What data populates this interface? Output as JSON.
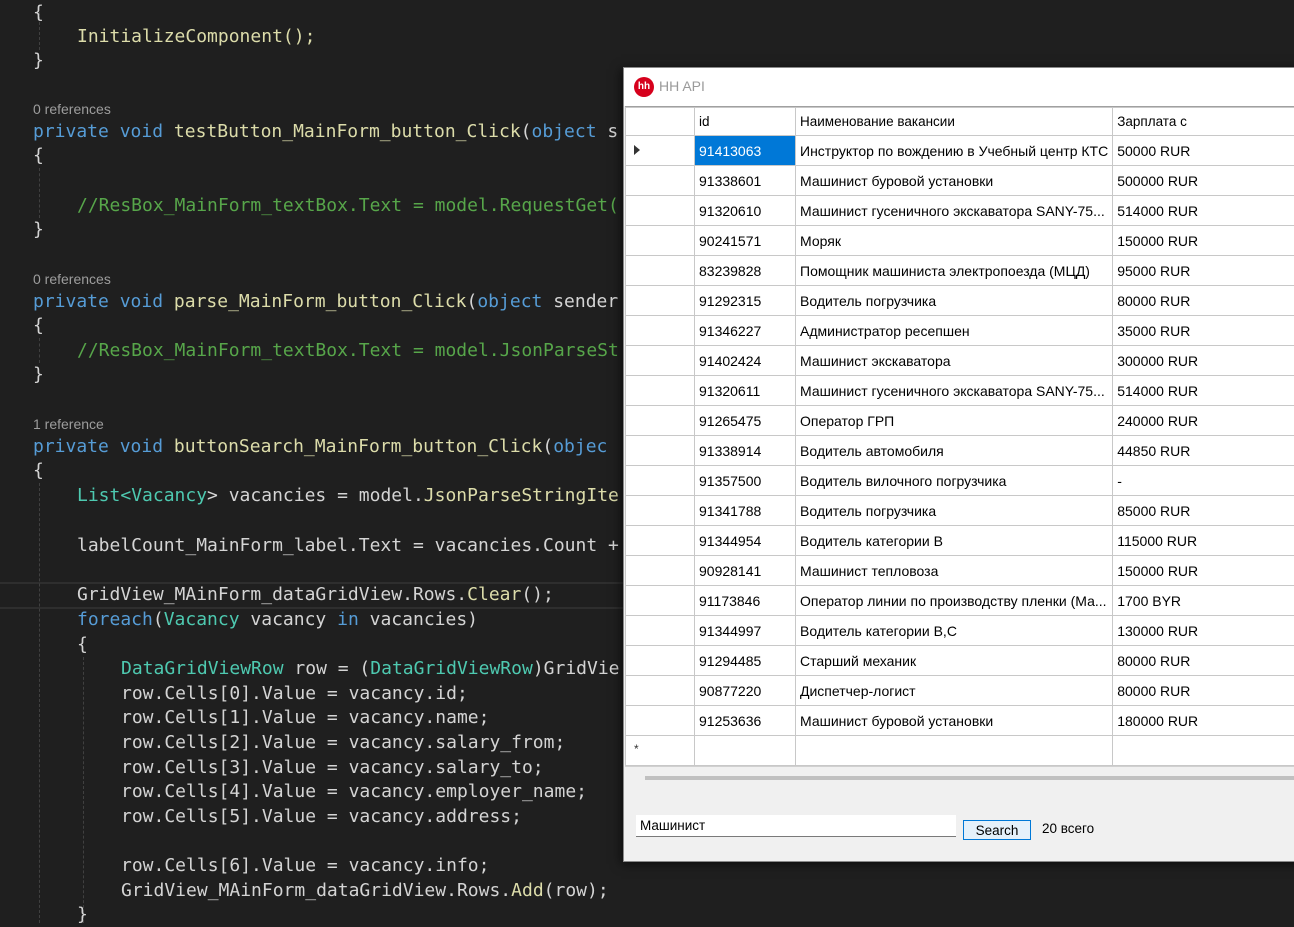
{
  "editor": {
    "lines": {
      "l1": "{",
      "l2": "InitializeComponent();",
      "l3": "}",
      "ref1": "0 references",
      "l5_kw": "private void",
      "l5_fn": "testButton_MainForm_button_Click",
      "l5_p": "(",
      "l5_ty": "object",
      "l5_rest": " s",
      "l6": "{",
      "l8": "//ResBox_MainForm_textBox.Text = model.RequestGet(",
      "l9": "}",
      "ref2": "0 references",
      "l11_kw": "private void",
      "l11_fn": "parse_MainForm_button_Click",
      "l11_p": "(",
      "l11_ty": "object",
      "l11_rest": " sender",
      "l12": "{",
      "l13": "//ResBox_MainForm_textBox.Text = model.JsonParseSt",
      "l14": "}",
      "ref3": "1 reference",
      "l16_kw": "private void",
      "l16_fn": "buttonSearch_MainForm_button_Click",
      "l16_p": "(",
      "l16_ty": "objec",
      "l17": "{",
      "l18_a": "List<",
      "l18_b": "Vacancy",
      "l18_c": "> vacancies = model.",
      "l18_d": "JsonParseStringIte",
      "l20_a": "labelCount_MainForm_label.Text = vacancies.Count +",
      "l22_a": "GridView_MAinForm_dataGridView.Rows.",
      "l22_b": "Clear",
      "l22_c": "();",
      "l23_a": "foreach",
      "l23_b": "(",
      "l23_c": "Vacancy",
      "l23_d": " vacancy ",
      "l23_e": "in",
      "l23_f": " vacancies)",
      "l24": "{",
      "l25_a": "DataGridViewRow",
      "l25_b": " row = (",
      "l25_c": "DataGridViewRow",
      "l25_d": ")GridVie",
      "l26": "row.Cells[0].Value = vacancy.id;",
      "l27": "row.Cells[1].Value = vacancy.name;",
      "l28": "row.Cells[2].Value = vacancy.salary_from;",
      "l29": "row.Cells[3].Value = vacancy.salary_to;",
      "l30": "row.Cells[4].Value = vacancy.employer_name;",
      "l31": "row.Cells[5].Value = vacancy.address;",
      "l33": "row.Cells[6].Value = vacancy.info;",
      "l34_a": "GridView_MAinForm_dataGridView.Rows.",
      "l34_b": "Add",
      "l34_c": "(row);",
      "l35": "}"
    }
  },
  "window": {
    "logo": "hh",
    "title": "HH API"
  },
  "grid": {
    "columns": [
      "id",
      "Наименование вакансии",
      "Зарплата с"
    ],
    "rows": [
      {
        "id": "91413063",
        "name": "Инструктор по вождению в Учебный центр КТС",
        "salary": "50000 RUR"
      },
      {
        "id": "91338601",
        "name": "Машинист буровой установки",
        "salary": "500000 RUR"
      },
      {
        "id": "91320610",
        "name": "Машинист гусеничного экскаватора SANY-75...",
        "salary": "514000 RUR"
      },
      {
        "id": "90241571",
        "name": "Моряк",
        "salary": "150000 RUR"
      },
      {
        "id": "83239828",
        "name": "Помощник машиниста электропоезда (МЦД)",
        "salary": "95000 RUR"
      },
      {
        "id": "91292315",
        "name": "Водитель погрузчика",
        "salary": "80000 RUR"
      },
      {
        "id": "91346227",
        "name": "Администратор ресепшен",
        "salary": "35000 RUR"
      },
      {
        "id": "91402424",
        "name": "Машинист экскаватора",
        "salary": "300000 RUR"
      },
      {
        "id": "91320611",
        "name": "Машинист гусеничного экскаватора SANY-75...",
        "salary": "514000 RUR"
      },
      {
        "id": "91265475",
        "name": "Оператор ГРП",
        "salary": "240000 RUR"
      },
      {
        "id": "91338914",
        "name": "Водитель автомобиля",
        "salary": "44850 RUR"
      },
      {
        "id": "91357500",
        "name": "Водитель вилочного погрузчика",
        "salary": "-"
      },
      {
        "id": "91341788",
        "name": "Водитель погрузчика",
        "salary": "85000 RUR"
      },
      {
        "id": "91344954",
        "name": "Водитель категории В",
        "salary": "115000 RUR"
      },
      {
        "id": "90928141",
        "name": "Машинист тепловоза",
        "salary": "150000 RUR"
      },
      {
        "id": "91173846",
        "name": "Оператор линии по производству пленки (Ма...",
        "salary": "1700 BYR"
      },
      {
        "id": "91344997",
        "name": "Водитель категории В,С",
        "salary": "130000 RUR"
      },
      {
        "id": "91294485",
        "name": "Старший механик",
        "salary": "80000 RUR"
      },
      {
        "id": "90877220",
        "name": "Диспетчер-логист",
        "salary": "80000 RUR"
      },
      {
        "id": "91253636",
        "name": "Машинист буровой установки",
        "salary": "180000 RUR"
      }
    ],
    "new_row_marker": "*"
  },
  "search": {
    "value": "Машинист",
    "button_label": "Search",
    "count_label": "20 всего"
  }
}
